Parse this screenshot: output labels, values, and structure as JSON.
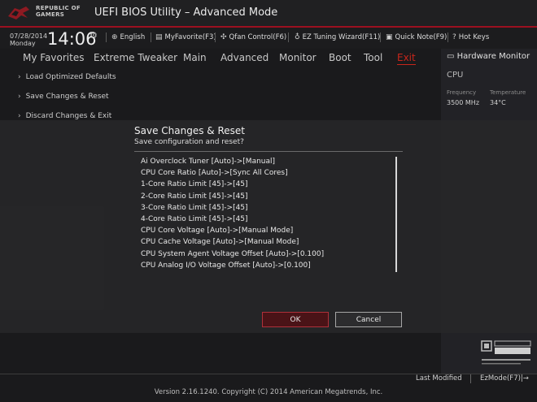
{
  "header": {
    "brand_line1": "REPUBLIC OF",
    "brand_line2": "GAMERS",
    "title": "UEFI BIOS Utility – Advanced Mode"
  },
  "infobar": {
    "date": "07/28/2014",
    "day": "Monday",
    "time": "14:06",
    "items": [
      {
        "icon": "globe-icon",
        "label": "English"
      },
      {
        "icon": "favorite-icon",
        "label": "MyFavorite(F3)"
      },
      {
        "icon": "fan-icon",
        "label": "Qfan Control(F6)"
      },
      {
        "icon": "bulb-icon",
        "label": "EZ Tuning Wizard(F11)"
      },
      {
        "icon": "note-icon",
        "label": "Quick Note(F9)"
      },
      {
        "icon": "hotkeys-icon",
        "label": "Hot Keys"
      }
    ]
  },
  "menu": {
    "items": [
      "My Favorites",
      "Extreme Tweaker",
      "Main",
      "Advanced",
      "Monitor",
      "Boot",
      "Tool",
      "Exit"
    ],
    "active": "Exit"
  },
  "options": [
    "Load Optimized Defaults",
    "Save Changes & Reset",
    "Discard Changes & Exit"
  ],
  "hardware_monitor": {
    "title": "Hardware Monitor",
    "section": "CPU",
    "frequency_label": "Frequency",
    "temperature_label": "Temperature",
    "frequency": "3500 MHz",
    "temperature": "34°C"
  },
  "dialog": {
    "title": "Save Changes & Reset",
    "subtitle": "Save configuration and reset?",
    "changes": [
      "Ai Overclock Tuner [Auto]->[Manual]",
      "CPU Core Ratio [Auto]->[Sync All Cores]",
      "1-Core Ratio Limit [45]->[45]",
      "2-Core Ratio Limit [45]->[45]",
      "3-Core Ratio Limit [45]->[45]",
      "4-Core Ratio Limit [45]->[45]",
      "CPU Core Voltage [Auto]->[Manual Mode]",
      "CPU Cache Voltage [Auto]->[Manual Mode]",
      "CPU System Agent Voltage Offset [Auto]->[0.100]",
      "CPU Analog I/O Voltage Offset [Auto]->[0.100]"
    ],
    "ok_label": "OK",
    "cancel_label": "Cancel"
  },
  "footer": {
    "last_modified": "Last Modified",
    "ezmode": "EzMode(F7)|→",
    "version": "Version 2.16.1240. Copyright (C) 2014 American Megatrends, Inc."
  },
  "colors": {
    "accent": "#c8261b",
    "background": "#1a1a1c",
    "ok_border": "#b0303a"
  }
}
